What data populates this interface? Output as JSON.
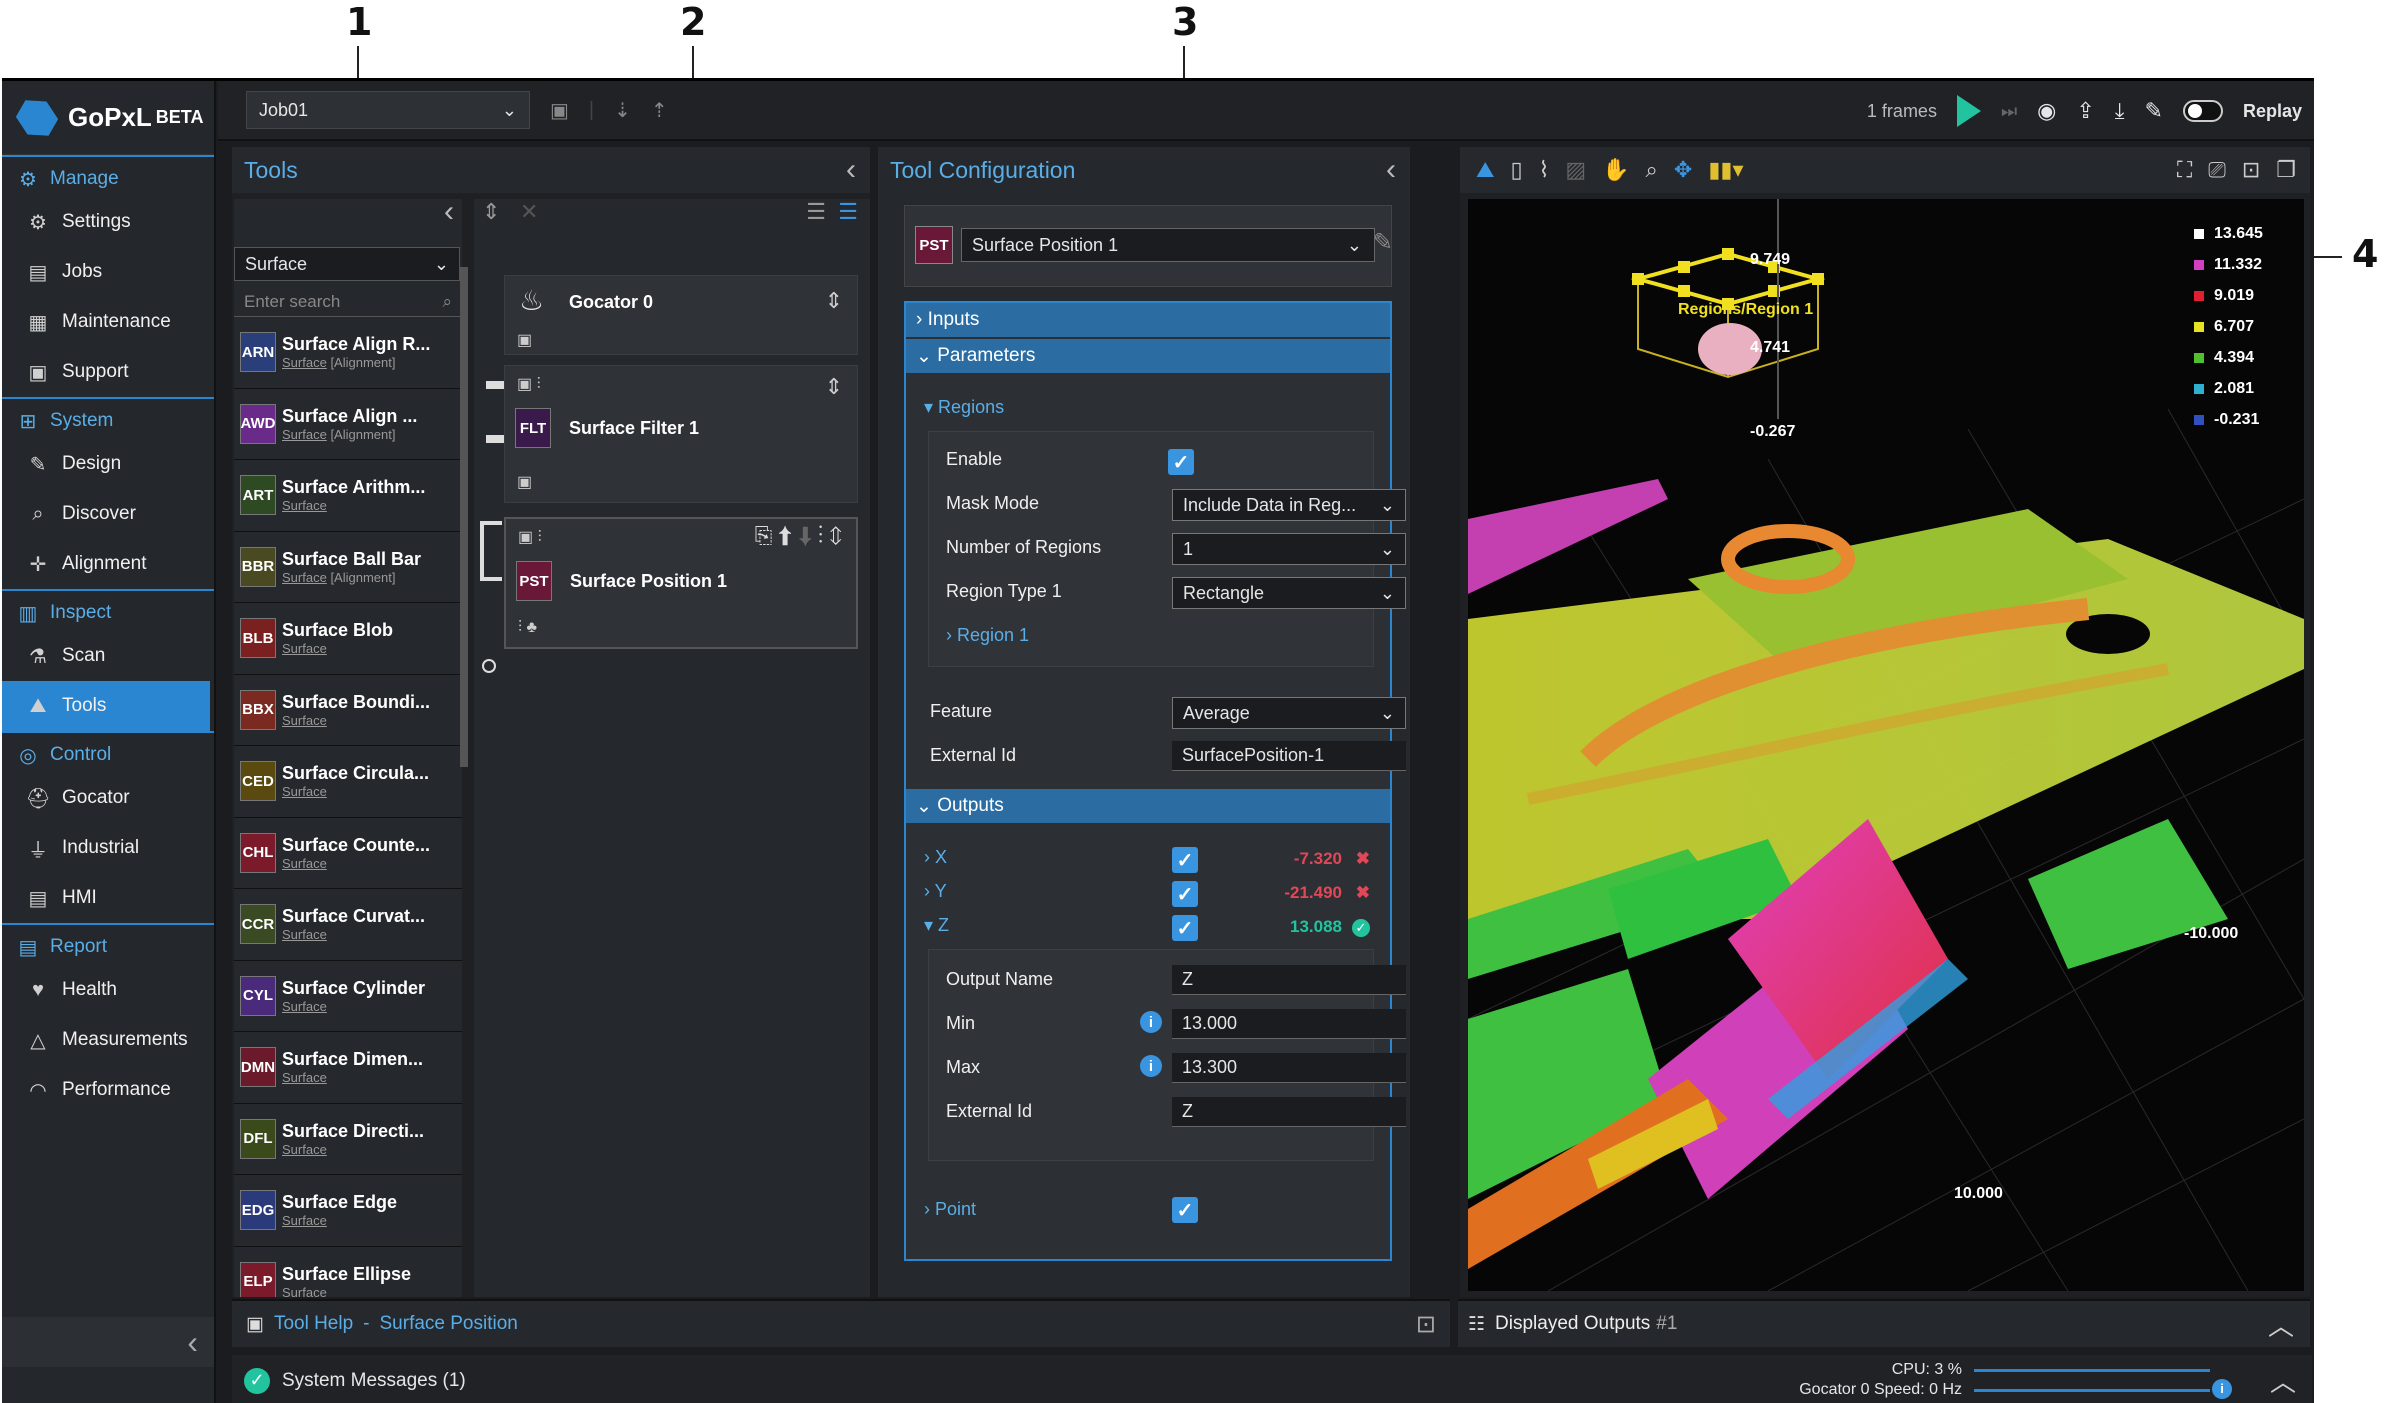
{
  "callouts": [
    "1",
    "2",
    "3",
    "4"
  ],
  "app": {
    "logo": "GoPxL",
    "logo_badge": "BETA"
  },
  "sidebar": {
    "groups": [
      {
        "head": "Manage",
        "icon": "gears-icon",
        "items": [
          {
            "label": "Settings",
            "icon": "gear-icon"
          },
          {
            "label": "Jobs",
            "icon": "document-icon"
          },
          {
            "label": "Maintenance",
            "icon": "maintenance-icon"
          },
          {
            "label": "Support",
            "icon": "support-icon"
          }
        ]
      },
      {
        "head": "System",
        "icon": "network-icon",
        "items": [
          {
            "label": "Design",
            "icon": "design-icon"
          },
          {
            "label": "Discover",
            "icon": "discover-icon"
          },
          {
            "label": "Alignment",
            "icon": "alignment-icon"
          }
        ]
      },
      {
        "head": "Inspect",
        "icon": "inspect-icon",
        "items": [
          {
            "label": "Scan",
            "icon": "scan-icon"
          },
          {
            "label": "Tools",
            "icon": "tools-icon"
          }
        ]
      },
      {
        "head": "Control",
        "icon": "control-icon",
        "items": [
          {
            "label": "Gocator",
            "icon": "sensor-icon"
          },
          {
            "label": "Industrial",
            "icon": "plug-icon"
          },
          {
            "label": "HMI",
            "icon": "hmi-icon"
          }
        ]
      },
      {
        "head": "Report",
        "icon": "report-icon",
        "items": [
          {
            "label": "Health",
            "icon": "heart-icon"
          },
          {
            "label": "Measurements",
            "icon": "measure-icon"
          },
          {
            "label": "Performance",
            "icon": "gauge-icon"
          }
        ]
      }
    ],
    "active": "Tools"
  },
  "topbar": {
    "job": "Job01",
    "frames": "1 frames",
    "replay": "Replay"
  },
  "tools_panel": {
    "title": "Tools",
    "category": "Surface",
    "search_placeholder": "Enter search",
    "tools": [
      {
        "abbr": "ARN",
        "color": "#2a3f7a",
        "name": "Surface Align R...",
        "sub": "Surface",
        "tag": "[Alignment]"
      },
      {
        "abbr": "AWD",
        "color": "#6a2a8a",
        "name": "Surface Align ...",
        "sub": "Surface",
        "tag": "[Alignment]"
      },
      {
        "abbr": "ART",
        "color": "#2d4a22",
        "name": "Surface Arithm...",
        "sub": "Surface",
        "tag": ""
      },
      {
        "abbr": "BBR",
        "color": "#4a4a22",
        "name": "Surface Ball Bar",
        "sub": "Surface",
        "tag": "[Alignment]"
      },
      {
        "abbr": "BLB",
        "color": "#7a2020",
        "name": "Surface Blob",
        "sub": "Surface",
        "tag": ""
      },
      {
        "abbr": "BBX",
        "color": "#7a2a20",
        "name": "Surface Boundi...",
        "sub": "Surface",
        "tag": ""
      },
      {
        "abbr": "CED",
        "color": "#5a4a10",
        "name": "Surface Circula...",
        "sub": "Surface",
        "tag": ""
      },
      {
        "abbr": "CHL",
        "color": "#7a1a2a",
        "name": "Surface Counte...",
        "sub": "Surface",
        "tag": ""
      },
      {
        "abbr": "CCR",
        "color": "#3a4a22",
        "name": "Surface Curvat...",
        "sub": "Surface",
        "tag": ""
      },
      {
        "abbr": "CYL",
        "color": "#4a2a7a",
        "name": "Surface Cylinder",
        "sub": "Surface",
        "tag": ""
      },
      {
        "abbr": "DMN",
        "color": "#6a1a2a",
        "name": "Surface Dimen...",
        "sub": "Surface",
        "tag": ""
      },
      {
        "abbr": "DFL",
        "color": "#3a4a1a",
        "name": "Surface Directi...",
        "sub": "Surface",
        "tag": ""
      },
      {
        "abbr": "EDG",
        "color": "#2a3a7a",
        "name": "Surface Edge",
        "sub": "Surface",
        "tag": ""
      },
      {
        "abbr": "ELP",
        "color": "#7a1a2a",
        "name": "Surface Ellipse",
        "sub": "Surface",
        "tag": ""
      }
    ]
  },
  "flow": {
    "nodes": [
      {
        "name": "Gocator 0",
        "abbr": ""
      },
      {
        "name": "Surface Filter 1",
        "abbr": "FLT"
      },
      {
        "name": "Surface Position 1",
        "abbr": "PST"
      }
    ]
  },
  "config": {
    "title": "Tool Configuration",
    "tool_abbr": "PST",
    "tool_name": "Surface Position 1",
    "sections": {
      "inputs": "Inputs",
      "parameters": "Parameters",
      "outputs": "Outputs"
    },
    "regions_label": "Regions",
    "enable_label": "Enable",
    "mask_mode_label": "Mask Mode",
    "mask_mode": "Include Data in Reg...",
    "num_regions_label": "Number of Regions",
    "num_regions": "1",
    "region_type_label": "Region Type 1",
    "region_type": "Rectangle",
    "region1_label": "Region 1",
    "feature_label": "Feature",
    "feature": "Average",
    "extid_label": "External Id",
    "extid": "SurfacePosition-1",
    "outputs": [
      {
        "name": "X",
        "value": "-7.320",
        "status": "fail"
      },
      {
        "name": "Y",
        "value": "-21.490",
        "status": "fail"
      },
      {
        "name": "Z",
        "value": "13.088",
        "status": "pass"
      }
    ],
    "z_detail": {
      "output_name_label": "Output Name",
      "output_name": "Z",
      "min_label": "Min",
      "min": "13.000",
      "max_label": "Max",
      "max": "13.300",
      "extid_label": "External Id",
      "extid": "Z"
    },
    "point_label": "Point"
  },
  "viewer": {
    "legend": [
      {
        "value": "13.645",
        "color": "#ffffff"
      },
      {
        "value": "11.332",
        "color": "#d040c0"
      },
      {
        "value": "9.019",
        "color": "#e02030"
      },
      {
        "value": "6.707",
        "color": "#e8e020"
      },
      {
        "value": "4.394",
        "color": "#50c030"
      },
      {
        "value": "2.081",
        "color": "#30b0d0"
      },
      {
        "value": "-0.231",
        "color": "#3050c0"
      }
    ],
    "axis_labels": [
      "9.749",
      "4.741",
      "-0.267",
      "-10.000",
      "10.000"
    ],
    "region_label": "Regions/Region 1"
  },
  "bottom": {
    "help_prefix": "Tool Help",
    "help_title": "Surface Position",
    "displayed_outputs": "Displayed Outputs",
    "displayed_count": "#1",
    "messages": "System Messages (1)",
    "cpu": "CPU: 3 %",
    "speed": "Gocator 0 Speed: 0 Hz"
  }
}
